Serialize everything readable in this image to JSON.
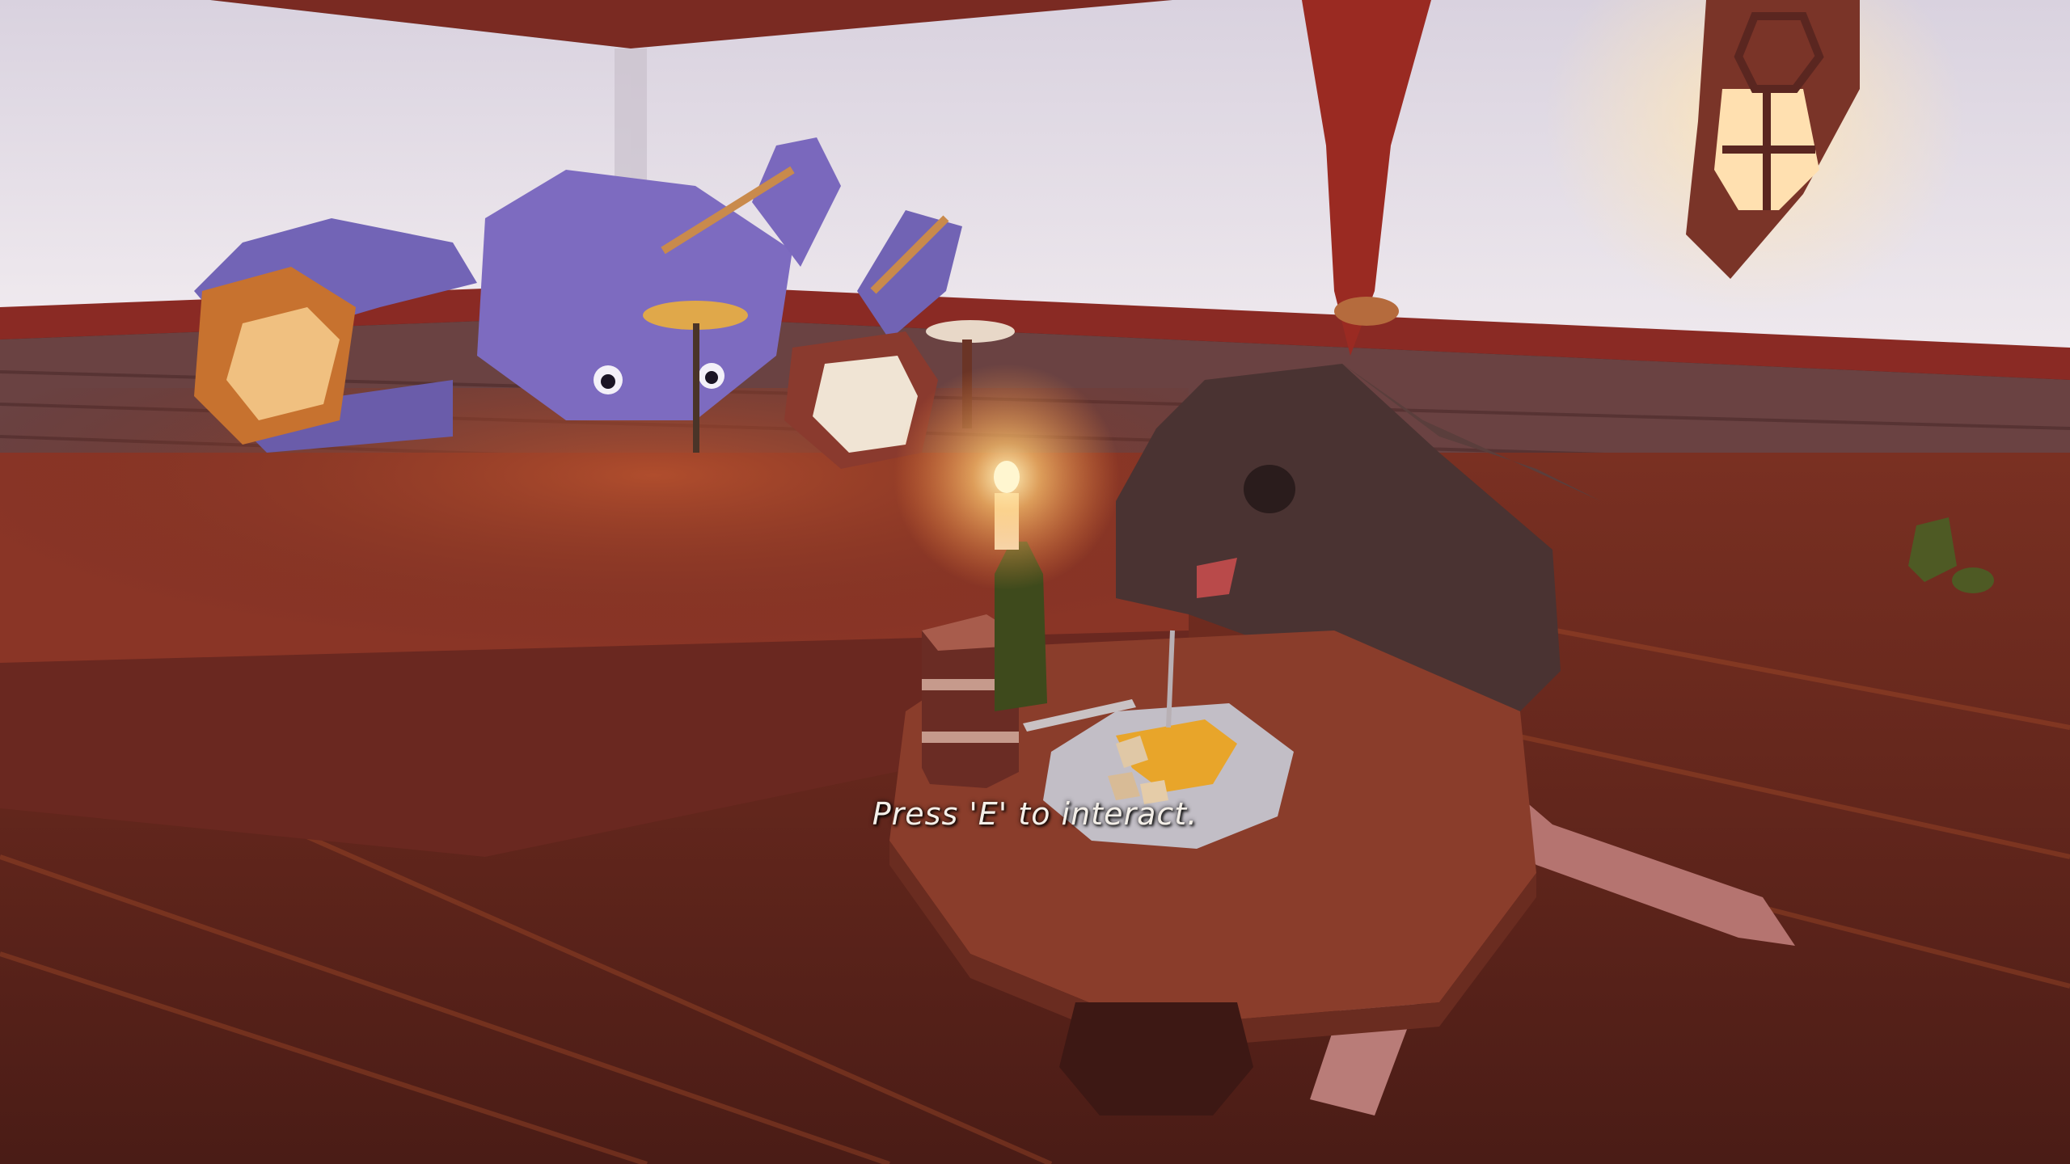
{
  "hud": {
    "interact_prompt": "Press 'E' to interact."
  },
  "scene": {
    "setting": "tavern-interior",
    "characters": [
      "octopus-drummer",
      "rat-patron"
    ],
    "props": [
      "drum-kit",
      "candle-bottle",
      "tankard",
      "plate-of-food",
      "wall-lantern",
      "red-curtain",
      "octagon-table"
    ]
  },
  "colors": {
    "wall": "#e4dde6",
    "floor": "#6b2a20",
    "stage": "#8a3526",
    "octopus": "#7d6bc0",
    "rat": "#4a3332",
    "candle_glow": "#ffd27a",
    "prompt_text": "#f4efe8"
  }
}
